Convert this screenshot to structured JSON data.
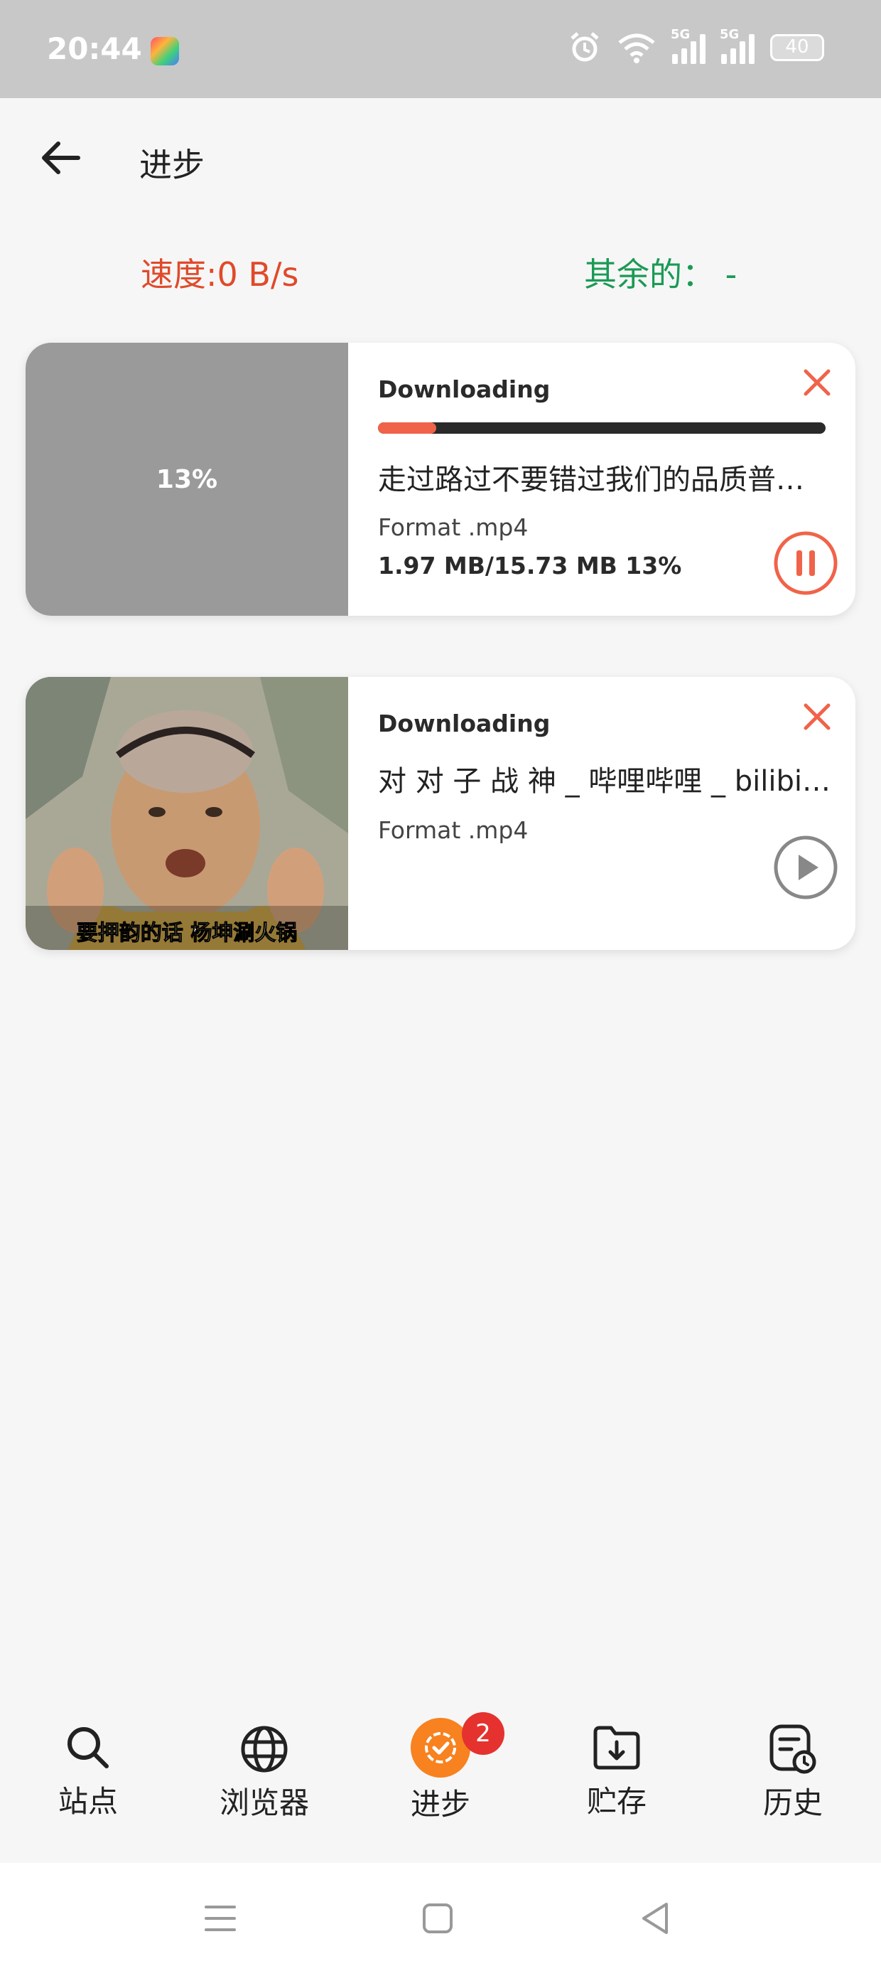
{
  "status_bar": {
    "time": "20:44",
    "battery": "40",
    "net1": "5G",
    "net2": "5G"
  },
  "header": {
    "title": "进步"
  },
  "stats": {
    "speed": "速度:0 B/s",
    "remaining": "其余的： -"
  },
  "downloads": [
    {
      "thumb_label": "13%",
      "status": "Downloading",
      "progress_percent": 13,
      "name": "走过路过不要错过我们的品质普…",
      "format": "Format .mp4",
      "size": "1.97 MB/15.73 MB   13%",
      "action_icon": "pause-icon"
    },
    {
      "thumb_caption": "要押韵的话 杨坤涮火锅",
      "status": "Downloading",
      "name": "对 对 子 战 神 _ 哔哩哔哩 _ bilibili…",
      "format": "Format .mp4",
      "action_icon": "play-icon"
    }
  ],
  "bottom_nav": {
    "items": [
      {
        "label": "站点",
        "icon": "search-icon"
      },
      {
        "label": "浏览器",
        "icon": "globe-icon"
      },
      {
        "label": "进步",
        "icon": "progress-icon",
        "badge": "2"
      },
      {
        "label": "贮存",
        "icon": "folder-download-icon"
      },
      {
        "label": "历史",
        "icon": "history-icon"
      }
    ]
  },
  "colors": {
    "accent": "#f0634a",
    "speed": "#e04a2a",
    "remaining": "#1a9a55",
    "nav_active": "#f7821f",
    "badge": "#e5322f"
  }
}
